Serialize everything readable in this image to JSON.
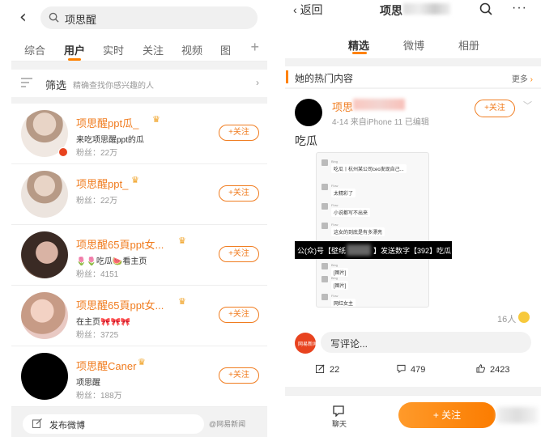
{
  "left": {
    "search_query": "项思醒",
    "tabs": [
      {
        "label": "综合"
      },
      {
        "label": "用户"
      },
      {
        "label": "实时"
      },
      {
        "label": "关注"
      },
      {
        "label": "视频"
      },
      {
        "label": "图"
      }
    ],
    "tab_plus": "+",
    "filter": {
      "title": "筛选",
      "desc": "精确查找你感兴趣的人"
    },
    "users": [
      {
        "name": "项思醒ppt瓜_",
        "desc": "来吃项思醒ppt的瓜",
        "fans": "粉丝：22万",
        "follow": "+关注"
      },
      {
        "name": "项思醒ppt_",
        "desc": "",
        "fans": "粉丝：22万",
        "follow": "+关注"
      },
      {
        "name": "项思醒65頁ppt女...",
        "desc": "🌷🌷吃瓜🍉看主页",
        "fans": "粉丝：4151",
        "follow": "+关注"
      },
      {
        "name": "项思醒65頁ppt女...",
        "desc": "在主页🎀🎀🎀",
        "fans": "粉丝：3725",
        "follow": "+关注"
      },
      {
        "name": "项思醒Caner",
        "desc": "项思醒",
        "fans": "粉丝：188万",
        "follow": "+关注"
      }
    ],
    "post_label": "发布微博",
    "watermark": "@网易新闻"
  },
  "right": {
    "back": "返回",
    "title": "项思",
    "more_dots": "···",
    "tabs": [
      {
        "label": "精选"
      },
      {
        "label": "微博"
      },
      {
        "label": "相册"
      }
    ],
    "hot_title": "她的热门内容",
    "hot_more": "更多",
    "post": {
      "author": "项思",
      "meta": "4-14  来自iPhone 11 已编辑",
      "follow": "+关注",
      "text": "吃瓜",
      "overlay_left": "公(众)号【壁纸",
      "overlay_right": "】发送数字【392】吃瓜",
      "likes": "16人",
      "comment_placeholder": "写评论...",
      "commenter_badge": "网易新闻",
      "reposts": "22",
      "comments": "479",
      "likes_count": "2423"
    },
    "chat": [
      {
        "name": "Bing",
        "msg": "吃瓜丨杭州某公司ceo发现自己..."
      },
      {
        "name": "Flow",
        "msg": "太精彩了"
      },
      {
        "name": "Flow",
        "msg": "小说都写不出来"
      },
      {
        "name": "Flow",
        "msg": "这女的到底是有多漂亮"
      },
      {
        "name": "Bing",
        "msg": "[图片]"
      },
      {
        "name": "Bing",
        "msg": "[图片]"
      },
      {
        "name": "Flow",
        "msg": "网红女主"
      }
    ],
    "bottom": {
      "chat_label": "聊天",
      "follow_label": "+ 关注"
    }
  }
}
